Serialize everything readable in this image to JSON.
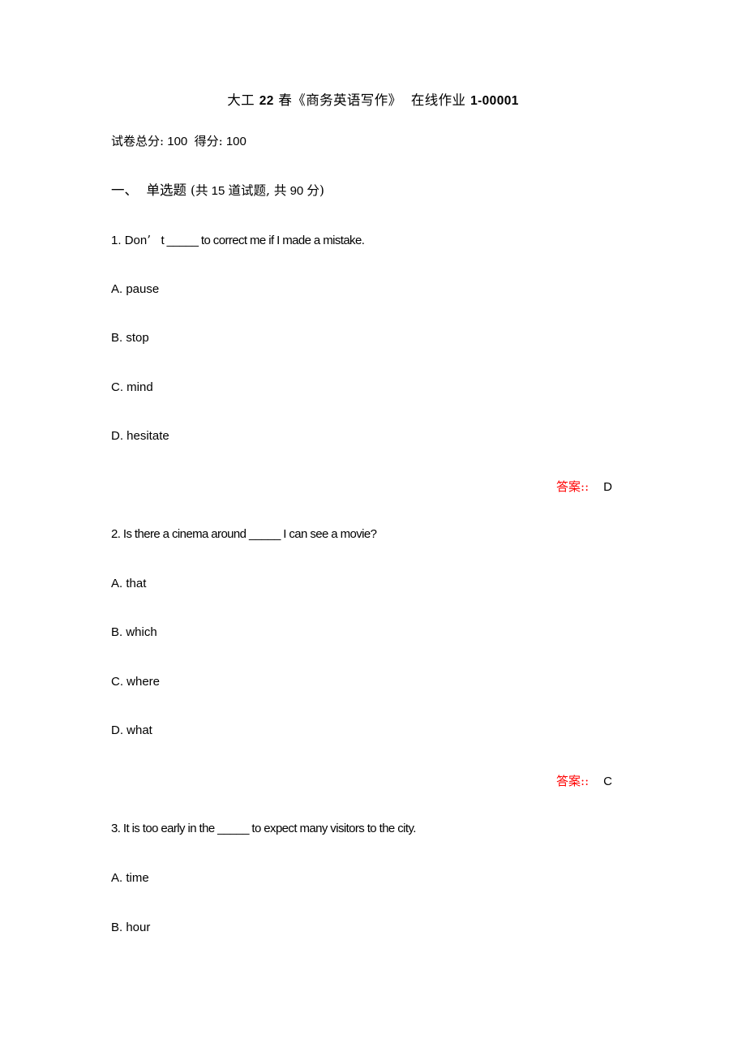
{
  "document": {
    "title_cjk_1": "大工",
    "title_num": "22",
    "title_cjk_2": "春《商务英语写作》",
    "title_cjk_3": "在线作业",
    "title_code": "1-00001",
    "title_full": "大工 22 春《商务英语写作》 在线作业 1-00001"
  },
  "score": {
    "total_label": "试卷总分:",
    "total_value": "100",
    "earned_label": "得分:",
    "earned_value": "100"
  },
  "section": {
    "index": "一、",
    "name": "单选题",
    "meta_open": "(共",
    "count": "15",
    "meta_mid": "道试题, 共",
    "points": "90",
    "meta_close": "分)"
  },
  "answer_label": "答案::",
  "questions": [
    {
      "number": "1.",
      "stem_before": "Don",
      "stem_apostrophe": "’",
      "stem_after": "t _____ to correct me if I made a mistake.",
      "stem_full": "1. Don’  t _____ to correct me if I made a mistake.",
      "options": [
        "A. pause",
        "B. stop",
        "C. mind",
        "D. hesitate"
      ],
      "answer": "D"
    },
    {
      "number": "2.",
      "stem_full": "2. Is there a cinema around _____ I can see a movie?",
      "options": [
        "A. that",
        "B. which",
        "C. where",
        "D. what"
      ],
      "answer": "C"
    },
    {
      "number": "3.",
      "stem_full": "3. It is too early in the _____ to expect many visitors to the city.",
      "options": [
        "A. time",
        "B. hour"
      ],
      "answer": ""
    }
  ],
  "colors": {
    "page_background": "#ffffff",
    "text": "#000000",
    "answer_label": "#ff0000"
  }
}
